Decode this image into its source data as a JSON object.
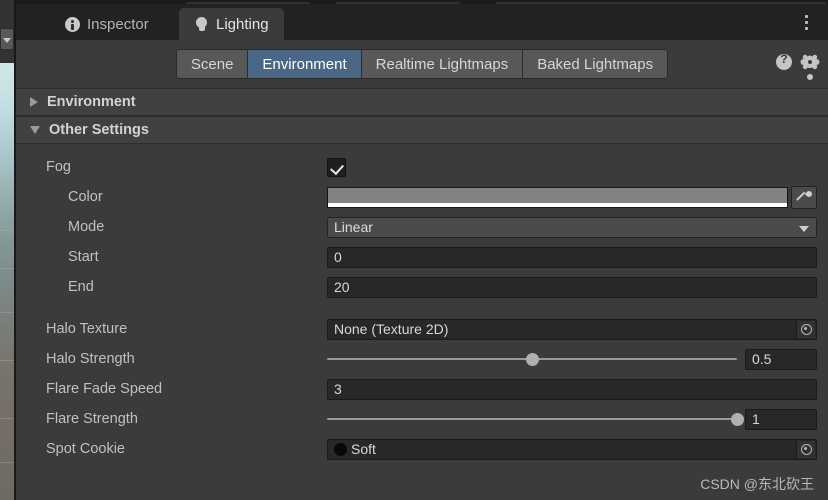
{
  "window": {
    "tabs": [
      {
        "label": "Inspector",
        "icon": "info-icon",
        "active": false
      },
      {
        "label": "Lighting",
        "icon": "lightbulb-icon",
        "active": true
      }
    ],
    "overflow_menu_icon": "kebab-menu-icon"
  },
  "toolbar": {
    "modes": [
      {
        "label": "Scene",
        "selected": false
      },
      {
        "label": "Environment",
        "selected": true
      },
      {
        "label": "Realtime Lightmaps",
        "selected": false
      },
      {
        "label": "Baked Lightmaps",
        "selected": false
      }
    ],
    "help_icon": "help-icon",
    "settings_icon": "gear-icon",
    "selected_color": "#4a6785"
  },
  "sections": [
    {
      "title": "Environment",
      "expanded": false
    },
    {
      "title": "Other Settings",
      "expanded": true
    }
  ],
  "properties": {
    "fog": {
      "label": "Fog",
      "checked": true
    },
    "color": {
      "label": "Color",
      "swatch": "#828282",
      "alpha_bar": "#ffffff",
      "eyedropper_icon": "eyedropper-icon"
    },
    "mode": {
      "label": "Mode",
      "value": "Linear"
    },
    "start": {
      "label": "Start",
      "value": "0"
    },
    "end": {
      "label": "End",
      "value": "20"
    },
    "halo_texture": {
      "label": "Halo Texture",
      "value": "None (Texture 2D)",
      "picker_icon": "object-picker-icon"
    },
    "halo_strength": {
      "label": "Halo Strength",
      "value": "0.5",
      "percent": 50
    },
    "flare_fade_speed": {
      "label": "Flare Fade Speed",
      "value": "3"
    },
    "flare_strength": {
      "label": "Flare Strength",
      "value": "1",
      "percent": 100
    },
    "spot_cookie": {
      "label": "Spot Cookie",
      "value": "Soft",
      "swatch": "#090909",
      "picker_icon": "object-picker-icon"
    }
  },
  "watermark": {
    "text": "CSDN @东北砍王"
  }
}
